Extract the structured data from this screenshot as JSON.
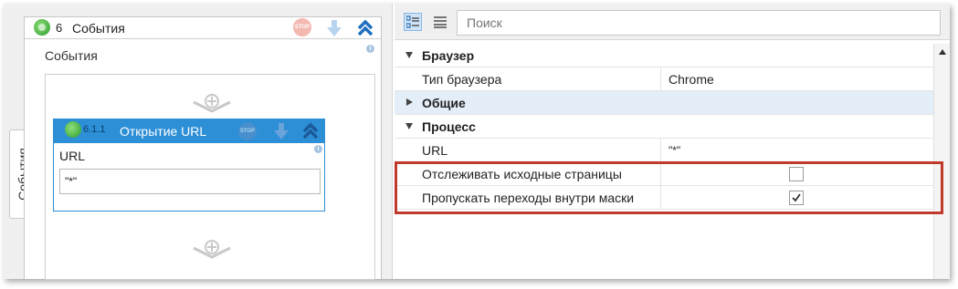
{
  "left": {
    "side_tab": "События",
    "activity": {
      "number": "6",
      "title": "События",
      "label": "События",
      "stop_label": "STOP",
      "info": "i"
    },
    "inner": {
      "number": "6.1.1",
      "title": "Открытие URL",
      "url_label": "URL",
      "url_value": "\"*\"",
      "info": "i"
    }
  },
  "right": {
    "search_placeholder": "Поиск",
    "categories": [
      {
        "name": "Браузер",
        "expanded": true,
        "props": [
          {
            "name": "Тип браузера",
            "value": "Chrome"
          }
        ]
      },
      {
        "name": "Общие",
        "expanded": false,
        "props": []
      },
      {
        "name": "Процесс",
        "expanded": true,
        "props": [
          {
            "name": "URL",
            "value": "\"*\""
          },
          {
            "name": "Отслеживать исходные страницы",
            "checked": false
          },
          {
            "name": "Пропускать переходы внутри маски",
            "checked": true
          }
        ]
      }
    ]
  },
  "colors": {
    "accent": "#2d8fd6",
    "highlight": "#c0392b",
    "selected_row": "#e4eef9"
  }
}
